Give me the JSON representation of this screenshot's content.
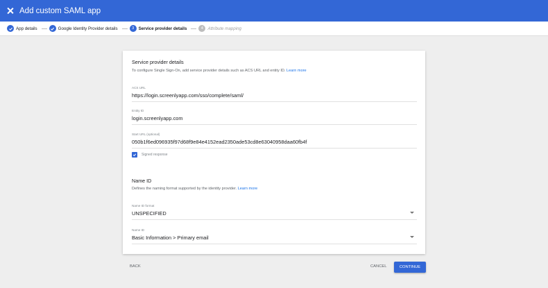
{
  "header": {
    "title": "Add custom SAML app",
    "close_icon": "close-icon"
  },
  "stepper": {
    "steps": [
      {
        "label": "App details",
        "state": "done"
      },
      {
        "label": "Google Identity Provider details",
        "state": "done"
      },
      {
        "label": "Service provider details",
        "state": "active",
        "number": "3"
      },
      {
        "label": "Attribute mapping",
        "state": "pending",
        "number": "4"
      }
    ]
  },
  "service_provider": {
    "title": "Service provider details",
    "description": "To configure Single Sign-On, add service provider details such as ACS URL and entity ID.",
    "learn_more": "Learn more",
    "acs_url": {
      "label": "ACS URL",
      "value": "https://login.screenlyapp.com/sso/complete/saml/"
    },
    "entity_id": {
      "label": "Entity ID",
      "value": "login.screenlyapp.com"
    },
    "start_url": {
      "label": "Start URL (optional)",
      "value": "050b1f6ed096935f97d68f9e84e4152ead2350ade53cd8e63040958daa60fb4f"
    },
    "signed_response": {
      "label": "Signed response",
      "checked": true
    }
  },
  "name_id": {
    "title": "Name ID",
    "description": "Defines the naming format supported by the identity provider.",
    "learn_more": "Learn more",
    "format": {
      "label": "Name ID format",
      "value": "UNSPECIFIED"
    },
    "name_id": {
      "label": "Name ID",
      "value": "Basic Information > Primary email"
    }
  },
  "footer": {
    "back": "BACK",
    "cancel": "CANCEL",
    "continue": "CONTINUE"
  },
  "colors": {
    "accent": "#3367d6",
    "link": "#1a73e8",
    "background": "#eeeeee"
  }
}
